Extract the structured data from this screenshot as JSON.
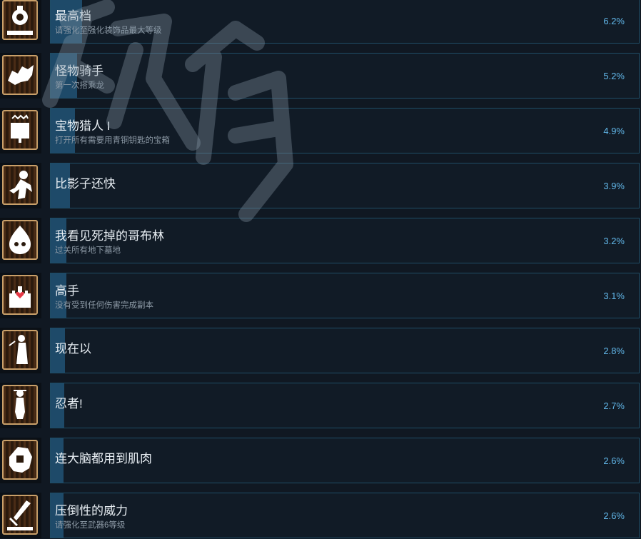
{
  "colors": {
    "background": "#101822",
    "card_bg": "#111b26",
    "card_border": "#1f4d66",
    "progress_fill": "#1e4a69",
    "title": "#e8eef3",
    "description": "#8d9aa6",
    "percent": "#62b8ea",
    "icon_border": "#c9a06a"
  },
  "achievements": [
    {
      "title": "最高档",
      "description": "请强化至强化装饰品最大等级",
      "percent": "6.2%",
      "fraction": 0.062,
      "icon": "ring-rank-icon"
    },
    {
      "title": "怪物骑手",
      "description": "第一次搭乘龙",
      "percent": "5.2%",
      "fraction": 0.052,
      "icon": "dragon-rider-icon"
    },
    {
      "title": "宝物猎人 I",
      "description": "打开所有需要用青铜钥匙的宝箱",
      "percent": "4.9%",
      "fraction": 0.049,
      "icon": "treasure-chest-icon"
    },
    {
      "title": "比影子还快",
      "description": "",
      "percent": "3.9%",
      "fraction": 0.039,
      "icon": "shadow-runner-icon"
    },
    {
      "title": "我看见死掉的哥布林",
      "description": "过关所有地下墓地",
      "percent": "3.2%",
      "fraction": 0.032,
      "icon": "goblin-ghost-icon"
    },
    {
      "title": "高手",
      "description": "没有受到任何伤害完成副本",
      "percent": "3.1%",
      "fraction": 0.031,
      "icon": "castle-heart-icon"
    },
    {
      "title": "现在以",
      "description": "",
      "percent": "2.8%",
      "fraction": 0.028,
      "icon": "wizard-figure-icon"
    },
    {
      "title": "忍者!",
      "description": "",
      "percent": "2.7%",
      "fraction": 0.027,
      "icon": "ninja-figure-icon"
    },
    {
      "title": "连大脑都用到肌肉",
      "description": "",
      "percent": "2.6%",
      "fraction": 0.026,
      "icon": "muscle-warrior-icon"
    },
    {
      "title": "压倒性的威力",
      "description": "请强化至武器6等级",
      "percent": "2.6%",
      "fraction": 0.026,
      "icon": "sword-rank-icon"
    }
  ]
}
